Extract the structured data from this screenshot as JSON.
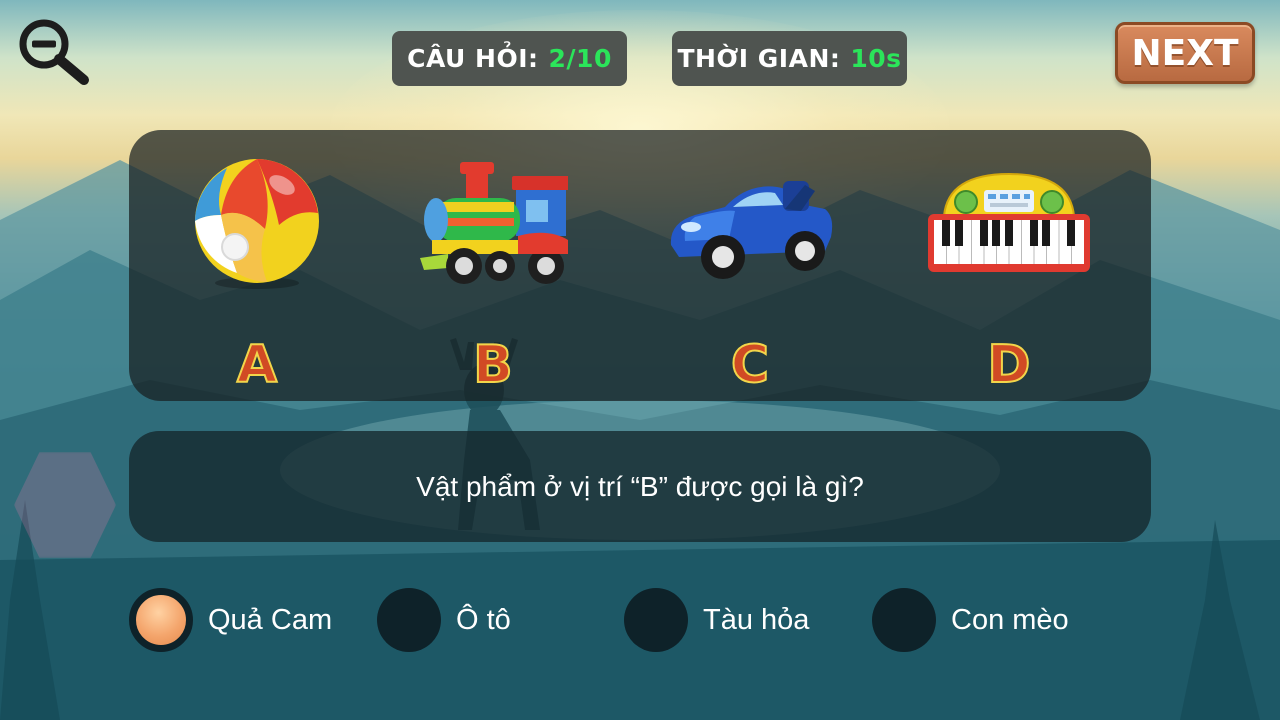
{
  "header": {
    "question_label": "CÂU HỎI:",
    "question_value": "2/10",
    "time_label": "THỜI GIAN:",
    "time_value": "10s",
    "next_label": "NEXT"
  },
  "items": [
    {
      "letter": "A",
      "icon": "beach-ball-icon"
    },
    {
      "letter": "B",
      "icon": "toy-train-icon"
    },
    {
      "letter": "C",
      "icon": "toy-car-icon"
    },
    {
      "letter": "D",
      "icon": "toy-piano-icon"
    }
  ],
  "question": "Vật phẩm ở vị trí “B” được gọi là gì?",
  "options": [
    {
      "label": "Quả Cam",
      "selected": true
    },
    {
      "label": "Ô tô",
      "selected": false
    },
    {
      "label": "Tàu hỏa",
      "selected": false
    },
    {
      "label": "Con mèo",
      "selected": false
    }
  ],
  "colors": {
    "accent_value": "#2be55a",
    "next_button": "#c17248",
    "letter_fill": "#d14a24",
    "letter_stroke": "#f2d54a",
    "selected_radio": "#f4a56c"
  }
}
